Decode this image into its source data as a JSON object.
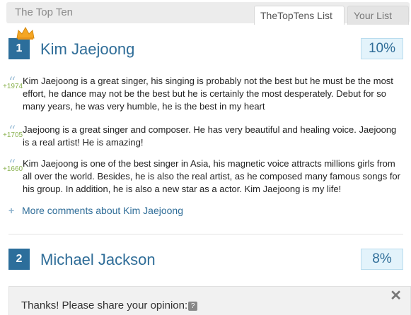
{
  "header": {
    "title": "The Top Ten",
    "tabs": [
      "TheTopTens List",
      "Your List"
    ]
  },
  "items": [
    {
      "rank": "1",
      "name": "Kim Jaejoong",
      "percent": "10%",
      "comments": [
        {
          "votes": "+1974",
          "text": "Kim Jaejoong is a great singer, his singing is probably not the best but he must be the most effort, he dance may not be the best but he is certainly the most desperately. Debut for so many years, he was very humble, he is the best in my heart"
        },
        {
          "votes": "+1705",
          "text": "Jaejoong is a great singer and composer. He has very beautiful and healing voice. Jaejoong is a real artist! He is amazing!"
        },
        {
          "votes": "+1660",
          "text": "Kim Jaejoong is one of the best singer in Asia, his magnetic voice attracts millions girls from all over the world. Besides, he is also the real artist, as he composed many famous songs for his group. In addition, he is also a new star as a actor. Kim Jaejoong is my life!"
        }
      ],
      "more_comments": "More comments about Kim Jaejoong"
    },
    {
      "rank": "2",
      "name": "Michael Jackson",
      "percent": "8%"
    }
  ],
  "share_panel": {
    "text": "Thanks! Please share your opinion:",
    "help_icon": "?",
    "close_icon": "✕"
  },
  "colors": {
    "rank_box": "#2c6e9b",
    "name": "#2f6d98",
    "percent_bg": "#e3f3fb",
    "votes": "#8cb352",
    "crown": "#f5a623"
  }
}
